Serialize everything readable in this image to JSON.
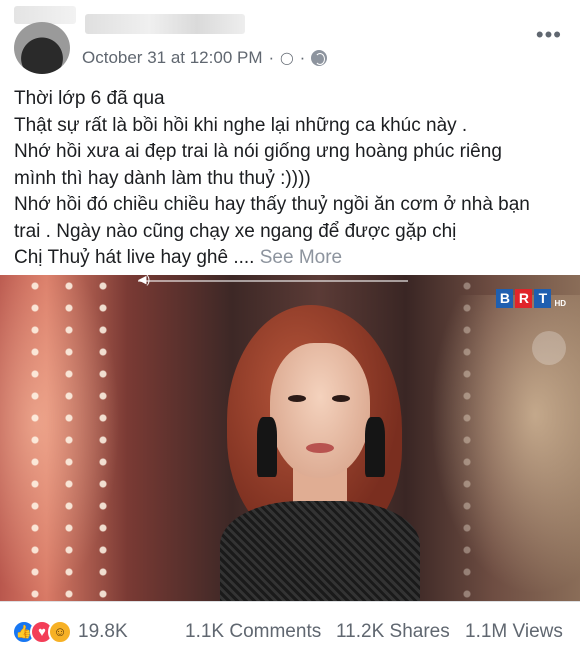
{
  "post": {
    "timestamp": "October 31 at 12:00 PM",
    "separator": "·",
    "lines": [
      "Thời lớp 6 đã qua",
      "Thật sự rất là bồi hồi khi nghe lại những ca khúc này .",
      "Nhớ hồi xưa ai đẹp trai là nói giống ưng hoàng phúc riêng",
      "mình thì hay dành làm thu thuỷ :))))",
      "Nhớ hồi đó chiều chiều hay thấy thuỷ ngồi ăn cơm ở nhà bạn",
      "trai . Ngày nào cũng chạy xe ngang để được gặp chị",
      "Chị Thuỷ hát live hay ghê ...."
    ],
    "see_more": "See More"
  },
  "video": {
    "channel_logo_letters": [
      "B",
      "R",
      "T"
    ],
    "channel_logo_suffix": "HD"
  },
  "stats": {
    "reaction_icons": [
      "like-icon",
      "love-icon",
      "haha-icon"
    ],
    "reactions_count": "19.8K",
    "comments": "1.1K Comments",
    "shares": "11.2K Shares",
    "views": "1.1M Views"
  },
  "colors": {
    "meta_text": "#606770",
    "like_blue": "#1877f2",
    "love_red": "#f33e58",
    "haha_yellow": "#f7b125"
  }
}
